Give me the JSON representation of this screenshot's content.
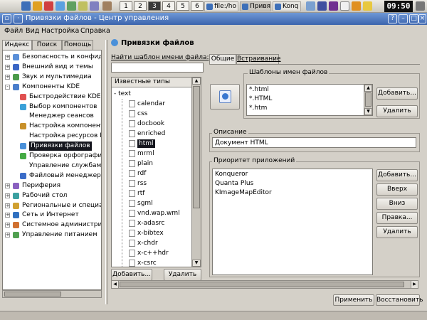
{
  "taskbar": {
    "desktops": [
      "1",
      "2",
      "3",
      "4",
      "5",
      "6"
    ],
    "active_desktop": "3",
    "tasks": [
      "file:/ho",
      "Привя",
      "Konq"
    ],
    "clock": "09:50"
  },
  "window": {
    "title": "Привязки файлов - Центр управления"
  },
  "menubar": [
    "Файл",
    "Вид",
    "Настройка",
    "Справка"
  ],
  "left_tabs": [
    "Индекс",
    "Поиск",
    "Помощь"
  ],
  "nav_tree": [
    {
      "label": "Безопасность и конфиденц",
      "level": 0,
      "expander": "+",
      "icon_color": "#5a8fd8",
      "icon": "security-icon"
    },
    {
      "label": "Внешний вид и темы",
      "level": 0,
      "expander": "+",
      "icon_color": "#3a66c4",
      "icon": "appearance-icon"
    },
    {
      "label": "Звук и мультимедиа",
      "level": 0,
      "expander": "+",
      "icon_color": "#4a9a4a",
      "icon": "sound-icon"
    },
    {
      "label": "Компоненты KDE",
      "level": 0,
      "expander": "-",
      "icon_color": "#4a7ecb",
      "icon": "kde-components-icon"
    },
    {
      "label": "Быстродействие KDE",
      "level": 1,
      "icon_color": "#e05050",
      "icon": "performance-icon"
    },
    {
      "label": "Выбор компонентов",
      "level": 1,
      "icon_color": "#3aa0d8",
      "icon": "component-chooser-icon"
    },
    {
      "label": "Менеджер сеансов",
      "level": 1,
      "icon_color": "",
      "icon": ""
    },
    {
      "label": "Настройка компонента",
      "level": 1,
      "icon_color": "#c8902a",
      "icon": "component-config-icon"
    },
    {
      "label": "Настройка ресурсов KDE",
      "level": 1,
      "icon_color": "",
      "icon": ""
    },
    {
      "label": "Привязки файлов",
      "level": 1,
      "icon_color": "#4a90d9",
      "icon": "file-associations-icon",
      "selected": true
    },
    {
      "label": "Проверка орфографии",
      "level": 1,
      "icon_color": "#44aa44",
      "icon": "spellcheck-icon"
    },
    {
      "label": "Управление службами",
      "level": 1,
      "icon_color": "",
      "icon": ""
    },
    {
      "label": "Файловый менеджер",
      "level": 1,
      "icon_color": "#3a6cc8",
      "icon": "file-manager-icon"
    },
    {
      "label": "Периферия",
      "level": 0,
      "expander": "+",
      "icon_color": "#8a60c0",
      "icon": "peripherals-icon"
    },
    {
      "label": "Рабочий стол",
      "level": 0,
      "expander": "+",
      "icon_color": "#3aa0a0",
      "icon": "desktop-icon"
    },
    {
      "label": "Региональные и специальны",
      "level": 0,
      "expander": "+",
      "icon_color": "#d0a030",
      "icon": "regional-icon"
    },
    {
      "label": "Сеть и Интернет",
      "level": 0,
      "expander": "+",
      "icon_color": "#3070c0",
      "icon": "network-icon"
    },
    {
      "label": "Системное администриров",
      "level": 0,
      "expander": "+",
      "icon_color": "#d07030",
      "icon": "system-admin-icon"
    },
    {
      "label": "Управление питанием",
      "level": 0,
      "expander": "+",
      "icon_color": "#50a050",
      "icon": "power-icon"
    }
  ],
  "module": {
    "title": "Привязки файлов",
    "find_label": "Найти шаблон имени файла:",
    "find_value": "",
    "known_types_header": "Известные типы",
    "root_type": "text",
    "types": [
      "calendar",
      "css",
      "docbook",
      "enriched",
      "html",
      "mrml",
      "plain",
      "rdf",
      "rss",
      "rtf",
      "sgml",
      "vnd.wap.wml",
      "x-adasrc",
      "x-bibtex",
      "x-chdr",
      "x-c++hdr",
      "x-csrc"
    ],
    "selected_type": "html",
    "add_button": "Добавить...",
    "delete_button": "Удалить",
    "tabs": [
      "Общие",
      "Встраивание"
    ],
    "patterns_title": "Шаблоны имен файлов",
    "patterns": [
      "*.html",
      "*.HTML",
      "*.htm"
    ],
    "patterns_add": "Добавить...",
    "patterns_delete": "Удалить",
    "description_title": "Описание",
    "description_value": "Документ HTML",
    "priority_title": "Приоритет приложений",
    "apps": [
      "Konqueror",
      "Quanta Plus",
      "KImageMapEditor"
    ],
    "app_buttons": [
      "Добавить...",
      "Вверх",
      "Вниз",
      "Правка...",
      "Удалить"
    ],
    "apply_button": "Применить",
    "reset_button": "Восстановить"
  }
}
